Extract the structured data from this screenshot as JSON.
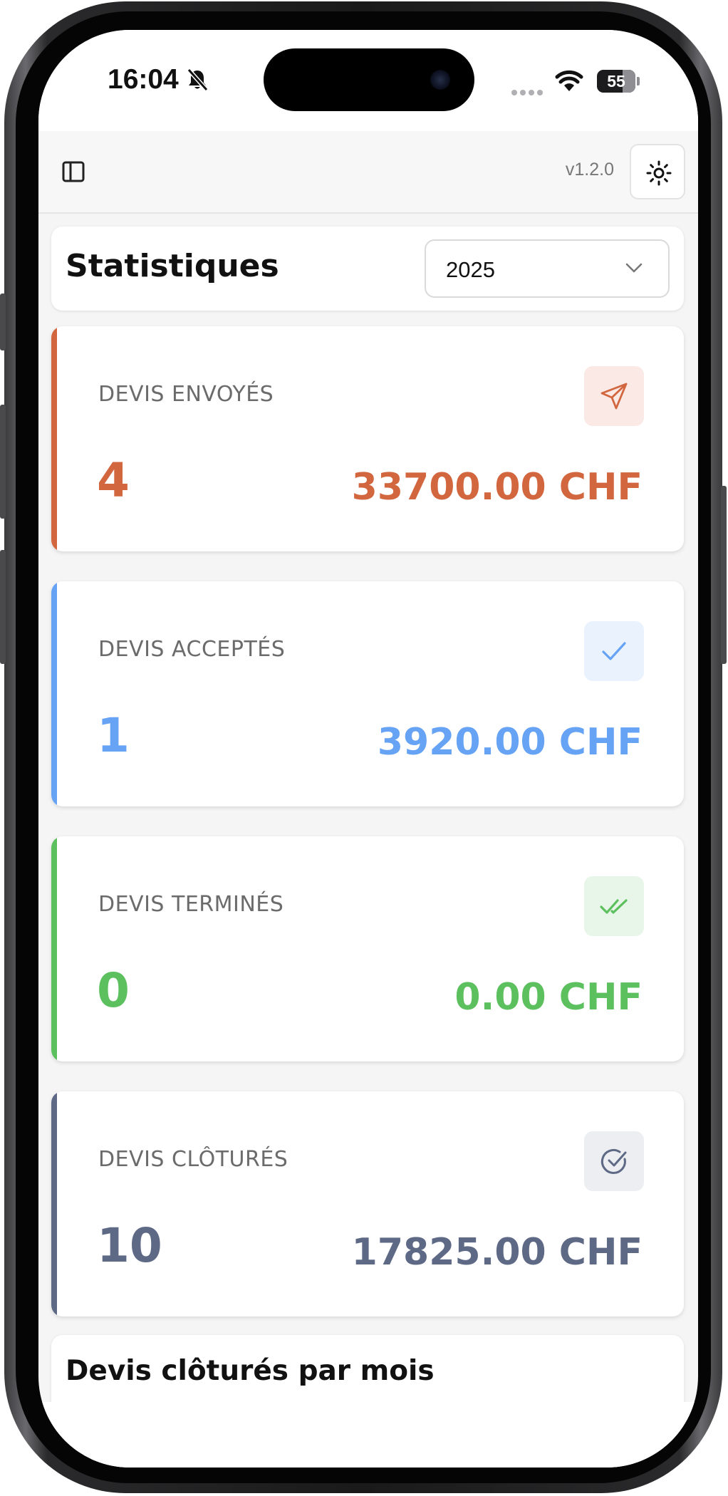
{
  "status_bar": {
    "time": "16:04",
    "battery": "55"
  },
  "header": {
    "version": "v1.2.0"
  },
  "page": {
    "title": "Statistiques",
    "year_selected": "2025"
  },
  "stats": [
    {
      "label": "DEVIS ENVOYÉS",
      "count": "4",
      "amount": "33700.00 CHF",
      "color": "#d2663f",
      "tint": "#fbe9e5",
      "icon": "send-icon"
    },
    {
      "label": "DEVIS ACCEPTÉS",
      "count": "1",
      "amount": "3920.00 CHF",
      "color": "#66a3f4",
      "tint": "#eaf2fe",
      "icon": "check-icon"
    },
    {
      "label": "DEVIS TERMINÉS",
      "count": "0",
      "amount": "0.00 CHF",
      "color": "#5cc05e",
      "tint": "#e7f6e8",
      "icon": "double-check-icon"
    },
    {
      "label": "DEVIS CLÔTURÉS",
      "count": "10",
      "amount": "17825.00 CHF",
      "color": "#5e6a85",
      "tint": "#eceef2",
      "icon": "circle-check-icon"
    }
  ],
  "monthly_chart": {
    "title": "Devis clôturés par mois"
  }
}
